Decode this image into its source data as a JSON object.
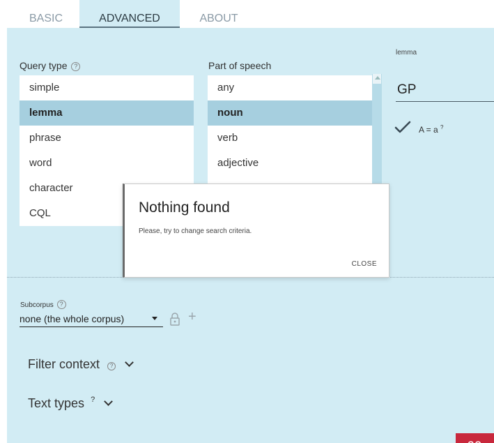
{
  "tabs": [
    {
      "label": "BASIC"
    },
    {
      "label": "ADVANCED",
      "active": true
    },
    {
      "label": "ABOUT"
    }
  ],
  "query_type": {
    "label": "Query type",
    "help": "?",
    "items": [
      "simple",
      "lemma",
      "phrase",
      "word",
      "character",
      "CQL"
    ],
    "selected": "lemma"
  },
  "part_of_speech": {
    "label": "Part of speech",
    "items": [
      "any",
      "noun",
      "verb",
      "adjective"
    ],
    "selected": "noun"
  },
  "lemma": {
    "label": "lemma",
    "value": "GP",
    "case_label": "A = a",
    "case_sup": "?"
  },
  "dialog": {
    "title": "Nothing found",
    "message": "Please, try to change search criteria.",
    "close": "CLOSE"
  },
  "subcorpus": {
    "label": "Subcorpus",
    "help": "?",
    "value": "none (the whole corpus)",
    "add": "+"
  },
  "filter_context": {
    "label": "Filter context",
    "help": "?"
  },
  "text_types": {
    "label": "Text types",
    "sup": "?"
  },
  "go": "GO",
  "colors": {
    "accent": "#c8283c",
    "panel": "#d2ecf4",
    "selected_row": "#a6cfdf"
  }
}
